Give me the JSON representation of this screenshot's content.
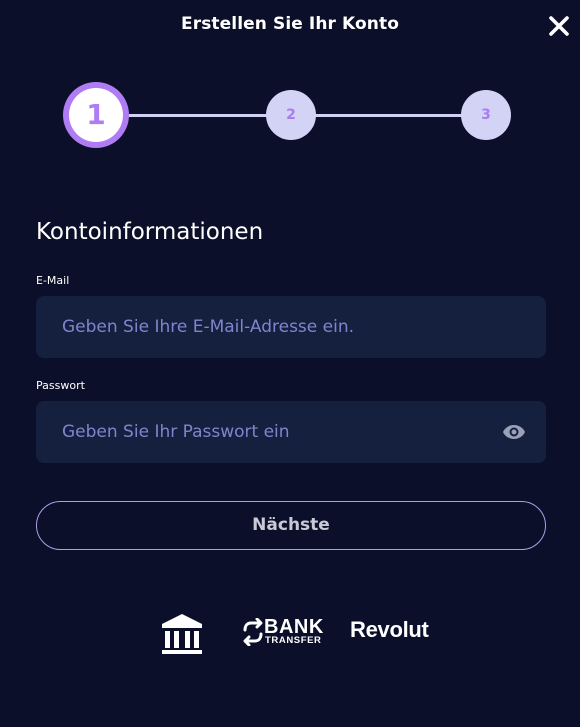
{
  "header": {
    "title": "Erstellen Sie Ihr Konto",
    "close_icon": "close-icon"
  },
  "stepper": {
    "current_step": 1,
    "steps": [
      {
        "label": "1",
        "state": "active"
      },
      {
        "label": "2",
        "state": "upcoming"
      },
      {
        "label": "3",
        "state": "upcoming"
      }
    ]
  },
  "form": {
    "section_title": "Kontoinformationen",
    "email": {
      "label": "E-Mail",
      "value": "",
      "placeholder": "Geben Sie Ihre E-Mail-Adresse ein."
    },
    "password": {
      "label": "Passwort",
      "value": "",
      "placeholder": "Geben Sie Ihr Passwort ein",
      "toggle_icon": "eye-icon"
    },
    "next_label": "Nächste"
  },
  "payment_methods": {
    "bank_icon": "bank-building-icon",
    "bank_transfer": {
      "primary": "BANK",
      "secondary": "TRANSFER",
      "icon": "transfer-arrows-icon"
    },
    "revolut": "Revolut"
  },
  "colors": {
    "background": "#0c0f29",
    "input_background": "#15203f",
    "accent": "#b07cf3",
    "step_idle": "#d3d3f6",
    "placeholder": "#7f85cd",
    "button_border": "#a6a2e4"
  }
}
